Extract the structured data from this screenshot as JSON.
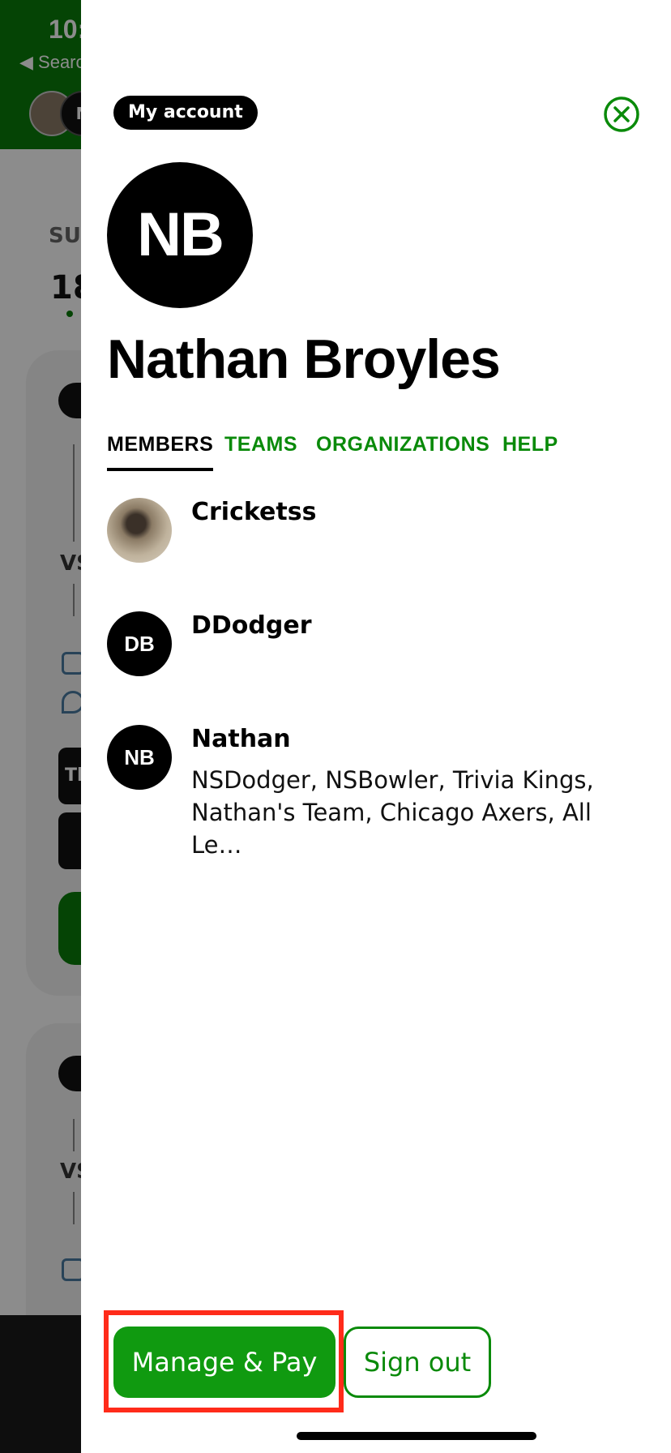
{
  "background": {
    "time": "10:",
    "back_label": "◀ Searc",
    "avatar_initial": "N",
    "day_label": "SU",
    "date": "18",
    "vs_label": "VS",
    "block_label": "Tl"
  },
  "drawer": {
    "account_label": "My account",
    "avatar_initials": "NB",
    "user_name": "Nathan Broyles",
    "tabs": [
      "MEMBERS",
      "TEAMS",
      "ORGANIZATIONS",
      "HELP"
    ],
    "active_tab": "MEMBERS",
    "members": [
      {
        "name": "Cricketss",
        "initials": "",
        "teams": "",
        "avatar": "photo"
      },
      {
        "name": "DDodger",
        "initials": "DB",
        "teams": ""
      },
      {
        "name": "Nathan",
        "initials": "NB",
        "teams": "NSDodger, NSBowler, Trivia Kings, Nathan's Team, Chicago Axers, All Le…"
      }
    ],
    "manage_pay_label": "Manage & Pay",
    "sign_out_label": "Sign out"
  },
  "colors": {
    "brand_green": "#0a8a0a",
    "button_green": "#109a10",
    "highlight_red": "#ff2b1a"
  }
}
